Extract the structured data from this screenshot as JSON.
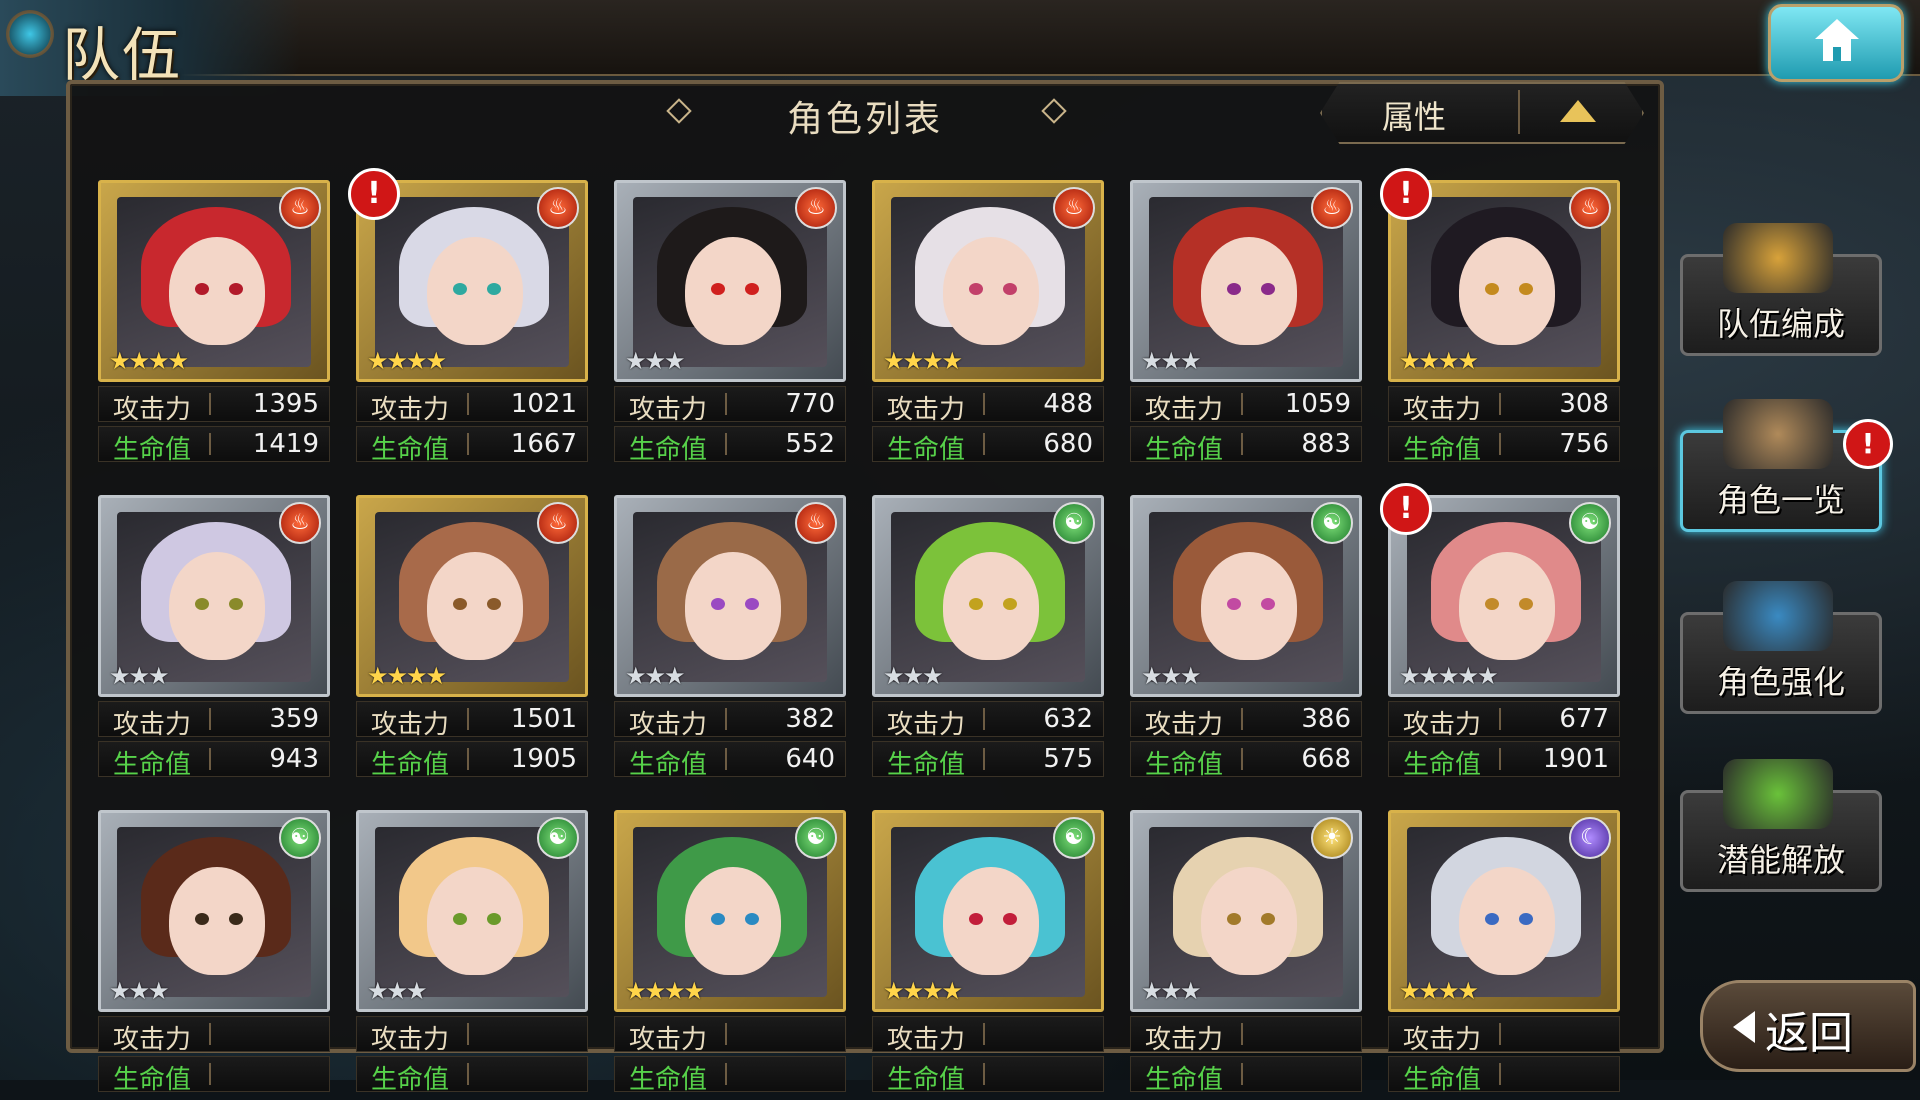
{
  "header": {
    "title": "队伍"
  },
  "panel": {
    "title": "角色列表",
    "sort_label": "属性"
  },
  "stat_labels": {
    "atk": "攻击力",
    "hp": "生命值"
  },
  "alert_text": "!",
  "element_glyphs": {
    "fire": "♨",
    "wind": "☯",
    "light": "☀",
    "dark": "☾"
  },
  "characters": [
    {
      "atk": "1395",
      "hp": "1419",
      "element": "fire",
      "stars": "★★★★",
      "alert": false,
      "frame": "gold",
      "hair": "#c8282e",
      "eyes": "#b21a2a"
    },
    {
      "atk": "1021",
      "hp": "1667",
      "element": "fire",
      "stars": "★★★★",
      "alert": true,
      "frame": "gold",
      "hair": "#d9d9e6",
      "eyes": "#2ea9a0"
    },
    {
      "atk": "770",
      "hp": "552",
      "element": "fire",
      "stars": "★★★",
      "alert": false,
      "frame": "silver",
      "hair": "#1e1a1a",
      "eyes": "#d0201e"
    },
    {
      "atk": "488",
      "hp": "680",
      "element": "fire",
      "stars": "★★★★",
      "alert": false,
      "frame": "gold",
      "hair": "#e6e0e6",
      "eyes": "#c2406a"
    },
    {
      "atk": "1059",
      "hp": "883",
      "element": "fire",
      "stars": "★★★",
      "alert": false,
      "frame": "silver",
      "hair": "#b53026",
      "eyes": "#8a2a8a"
    },
    {
      "atk": "308",
      "hp": "756",
      "element": "fire",
      "stars": "★★★★",
      "alert": true,
      "frame": "gold",
      "hair": "#1f1a22",
      "eyes": "#c48a1e"
    },
    {
      "atk": "359",
      "hp": "943",
      "element": "fire",
      "stars": "★★★",
      "alert": false,
      "frame": "silver",
      "hair": "#cfc8e2",
      "eyes": "#8a8a2a"
    },
    {
      "atk": "1501",
      "hp": "1905",
      "element": "fire",
      "stars": "★★★★",
      "alert": false,
      "frame": "gold",
      "hair": "#a86a4a",
      "eyes": "#8a5a2a"
    },
    {
      "atk": "382",
      "hp": "640",
      "element": "fire",
      "stars": "★★★",
      "alert": false,
      "frame": "silver",
      "hair": "#9a6a48",
      "eyes": "#9a4ac2"
    },
    {
      "atk": "632",
      "hp": "575",
      "element": "wind",
      "stars": "★★★",
      "alert": false,
      "frame": "silver",
      "hair": "#7cc23a",
      "eyes": "#c2a21e"
    },
    {
      "atk": "386",
      "hp": "668",
      "element": "wind",
      "stars": "★★★",
      "alert": false,
      "frame": "silver",
      "hair": "#9a5a3a",
      "eyes": "#c24aa2"
    },
    {
      "atk": "677",
      "hp": "1901",
      "element": "wind",
      "stars": "★★★★★",
      "alert": true,
      "frame": "silver",
      "hair": "#e08a8a",
      "eyes": "#c28a2a"
    },
    {
      "atk": "",
      "hp": "",
      "element": "wind",
      "stars": "★★★",
      "alert": false,
      "frame": "silver",
      "hair": "#5a2a1a",
      "eyes": "#3a2a1a"
    },
    {
      "atk": "",
      "hp": "",
      "element": "wind",
      "stars": "★★★",
      "alert": false,
      "frame": "silver",
      "hair": "#f2c88a",
      "eyes": "#6a9a2a"
    },
    {
      "atk": "",
      "hp": "",
      "element": "wind",
      "stars": "★★★★",
      "alert": false,
      "frame": "gold",
      "hair": "#3f9a48",
      "eyes": "#2a8ac2"
    },
    {
      "atk": "",
      "hp": "",
      "element": "wind",
      "stars": "★★★★",
      "alert": false,
      "frame": "gold",
      "hair": "#4ac2d2",
      "eyes": "#c21e3a"
    },
    {
      "atk": "",
      "hp": "",
      "element": "light",
      "stars": "★★★",
      "alert": false,
      "frame": "silver",
      "hair": "#e6d2b0",
      "eyes": "#a27a2a"
    },
    {
      "atk": "",
      "hp": "",
      "element": "dark",
      "stars": "★★★★",
      "alert": false,
      "frame": "gold",
      "hair": "#d2d6e0",
      "eyes": "#3a6ac2"
    }
  ],
  "sidebar": [
    {
      "label": "队伍编成",
      "alert": false,
      "active": false,
      "icon": "team-formation-icon",
      "color": "#d8a23a"
    },
    {
      "label": "角色一览",
      "alert": true,
      "active": true,
      "icon": "character-book-icon",
      "color": "#b08a5a"
    },
    {
      "label": "角色强化",
      "alert": false,
      "active": false,
      "icon": "enhance-icon",
      "color": "#3a8ac2"
    },
    {
      "label": "潜能解放",
      "alert": false,
      "active": false,
      "icon": "potential-orb-icon",
      "color": "#6ac23a"
    }
  ],
  "back_button": {
    "label": "返回"
  },
  "colors": {
    "gold_frame": "#d8b24a",
    "silver_frame": "#c0c6cc",
    "hp_green": "#57d24a",
    "alert_red": "#d01616",
    "accent_cyan": "#3fc7e6"
  }
}
